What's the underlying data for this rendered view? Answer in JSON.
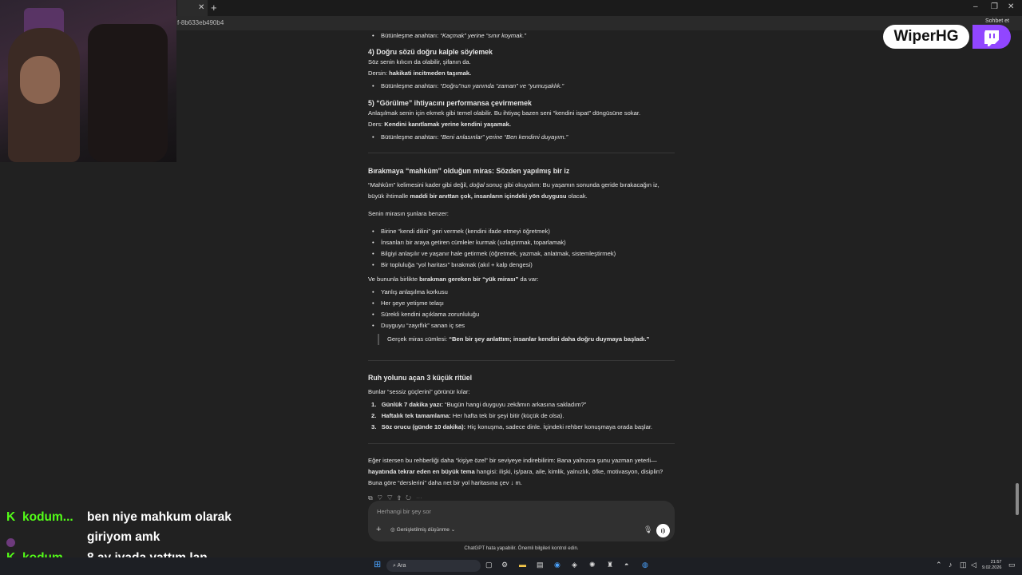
{
  "browser": {
    "tab_close": "✕",
    "new_tab": "+",
    "url_fragment": "f-8b633eb490b4",
    "chat_button": "Sohbet et",
    "window_controls": [
      "–",
      "❐",
      "✕"
    ]
  },
  "stream": {
    "brand": "WiperHG",
    "chat": [
      {
        "user": "kodum...",
        "lines": [
          "ben niye mahkum olarak",
          "giriyom amk"
        ]
      },
      {
        "user": "kodum...",
        "lines": [
          "8 ay jvada yattım lan"
        ]
      }
    ]
  },
  "article": {
    "s3_bullet": {
      "label": "Bütünleşme anahtarı: ",
      "text": "“Kaçmak” yerine “sınır koymak.”"
    },
    "s4": {
      "heading": "4) Doğru sözü doğru kalple söylemek",
      "l1": "Söz senin kılıcın da olabilir, şifanın da.",
      "l2_a": "Dersin: ",
      "l2_b": "hakikati incitmeden taşımak.",
      "bullet_label": "Bütünleşme anahtarı: ",
      "bullet_text": "“Doğru”nun yanında “zaman” ve “yumuşaklık.”"
    },
    "s5": {
      "heading": "5) “Görülme” ihtiyacını performansa çevirmemek",
      "l1": "Anlaşılmak senin için ekmek gibi temel olabilir. Bu ihtiyaç bazen seni “kendini ispat” döngüsüne sokar.",
      "l2_a": "Ders: ",
      "l2_b": "Kendini kanıtlamak yerine kendini yaşamak.",
      "bullet_label": "Bütünleşme anahtarı: ",
      "bullet_text": "“Beni anlasınlar” yerine “Ben kendimi duyayım.”"
    },
    "legacy": {
      "heading": "Bırakmaya “mahkûm” olduğun miras: Sözden yapılmış bir iz",
      "p1_a": "“Mahkûm” kelimesini kader gibi değil, ",
      "p1_b": "doğal sonuç",
      "p1_c": " gibi okuyalım: Bu yaşamın sonunda geride bırakacağın iz,",
      "p1_d": "büyük ihtimalle ",
      "p1_e": "maddi bir anıttan çok, insanların içindeki yön duygusu",
      "p1_f": " olacak.",
      "p2": "Senin mirasın şunlara benzer:",
      "list1": [
        "Birine “kendi dilini” geri vermek (kendini ifade etmeyi öğretmek)",
        "İnsanları bir araya getiren cümleler kurmak (uzlaştırmak, toparlamak)",
        "Bilgiyi anlaşılır ve yaşanır hale getirmek (öğretmek, yazmak, anlatmak, sistemleştirmek)",
        "Bir topluluğa “yol haritası” bırakmak (akıl + kalp dengesi)"
      ],
      "p3_a": "Ve bununla birlikte ",
      "p3_b": "bırakman gereken bir “yük mirası”",
      "p3_c": " da var:",
      "list2": [
        "Yanlış anlaşılma korkusu",
        "Her şeye yetişme telaşı",
        "Sürekli kendini açıklama zorunluluğu",
        "Duyguyu “zayıflık” sanan iç ses"
      ],
      "quote_a": "Gerçek miras cümlesi: ",
      "quote_b": "“Ben bir şey anlattım; insanlar kendini daha doğru duymaya başladı.”"
    },
    "rituals": {
      "heading": "Ruh yolunu açan 3 küçük ritüel",
      "intro": "Bunlar “sessiz güçlerini” görünür kılar:",
      "items": [
        {
          "n": "1.",
          "b": "Günlük 7 dakika yazı:",
          "t": " “Bugün hangi duyguyu zekâmın arkasına sakladım?”"
        },
        {
          "n": "2.",
          "b": "Haftalık tek tamamlama:",
          "t": " Her hafta tek bir şeyi bitir (küçük de olsa)."
        },
        {
          "n": "3.",
          "b": "Söz orucu (günde 10 dakika):",
          "t": " Hiç konuşma, sadece dinle. İçindeki rehber konuşmaya orada başlar."
        }
      ]
    },
    "closing": {
      "l1": "Eğer istersen bu rehberliği daha “kişiye özel” bir seviyeye indirebilirim: Bana yalnızca şunu yazman yeterli—",
      "l2_b": "hayatında tekrar eden en büyük tema",
      "l2_t": " hangisi: ilişki, iş/para, aile, kimlik, yalnızlık, öfke, motivasyon, disiplin?",
      "l3": "Buna göre “derslerini” daha net bir yol haritasına çev",
      "l3_end": " m."
    }
  },
  "composer": {
    "placeholder": "Herhangi bir şey sor",
    "tool": "Genişletilmiş düşünme",
    "disclaimer": "ChatGPT hata yapabilir. Önemli bilgileri kontrol edin."
  },
  "taskbar": {
    "search": "Ara",
    "time": "21:57",
    "date": "9.02.2026"
  }
}
